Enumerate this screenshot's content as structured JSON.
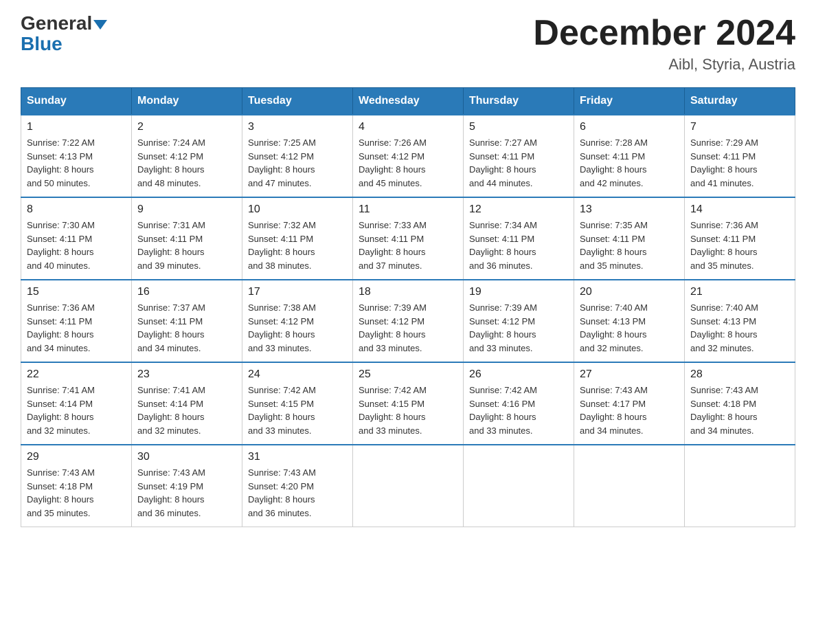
{
  "header": {
    "logo_line1": "General",
    "logo_line2": "Blue",
    "month_title": "December 2024",
    "subtitle": "Aibl, Styria, Austria"
  },
  "days_of_week": [
    "Sunday",
    "Monday",
    "Tuesday",
    "Wednesday",
    "Thursday",
    "Friday",
    "Saturday"
  ],
  "weeks": [
    [
      {
        "day": "1",
        "sunrise": "7:22 AM",
        "sunset": "4:13 PM",
        "daylight": "8 hours and 50 minutes."
      },
      {
        "day": "2",
        "sunrise": "7:24 AM",
        "sunset": "4:12 PM",
        "daylight": "8 hours and 48 minutes."
      },
      {
        "day": "3",
        "sunrise": "7:25 AM",
        "sunset": "4:12 PM",
        "daylight": "8 hours and 47 minutes."
      },
      {
        "day": "4",
        "sunrise": "7:26 AM",
        "sunset": "4:12 PM",
        "daylight": "8 hours and 45 minutes."
      },
      {
        "day": "5",
        "sunrise": "7:27 AM",
        "sunset": "4:11 PM",
        "daylight": "8 hours and 44 minutes."
      },
      {
        "day": "6",
        "sunrise": "7:28 AM",
        "sunset": "4:11 PM",
        "daylight": "8 hours and 42 minutes."
      },
      {
        "day": "7",
        "sunrise": "7:29 AM",
        "sunset": "4:11 PM",
        "daylight": "8 hours and 41 minutes."
      }
    ],
    [
      {
        "day": "8",
        "sunrise": "7:30 AM",
        "sunset": "4:11 PM",
        "daylight": "8 hours and 40 minutes."
      },
      {
        "day": "9",
        "sunrise": "7:31 AM",
        "sunset": "4:11 PM",
        "daylight": "8 hours and 39 minutes."
      },
      {
        "day": "10",
        "sunrise": "7:32 AM",
        "sunset": "4:11 PM",
        "daylight": "8 hours and 38 minutes."
      },
      {
        "day": "11",
        "sunrise": "7:33 AM",
        "sunset": "4:11 PM",
        "daylight": "8 hours and 37 minutes."
      },
      {
        "day": "12",
        "sunrise": "7:34 AM",
        "sunset": "4:11 PM",
        "daylight": "8 hours and 36 minutes."
      },
      {
        "day": "13",
        "sunrise": "7:35 AM",
        "sunset": "4:11 PM",
        "daylight": "8 hours and 35 minutes."
      },
      {
        "day": "14",
        "sunrise": "7:36 AM",
        "sunset": "4:11 PM",
        "daylight": "8 hours and 35 minutes."
      }
    ],
    [
      {
        "day": "15",
        "sunrise": "7:36 AM",
        "sunset": "4:11 PM",
        "daylight": "8 hours and 34 minutes."
      },
      {
        "day": "16",
        "sunrise": "7:37 AM",
        "sunset": "4:11 PM",
        "daylight": "8 hours and 34 minutes."
      },
      {
        "day": "17",
        "sunrise": "7:38 AM",
        "sunset": "4:12 PM",
        "daylight": "8 hours and 33 minutes."
      },
      {
        "day": "18",
        "sunrise": "7:39 AM",
        "sunset": "4:12 PM",
        "daylight": "8 hours and 33 minutes."
      },
      {
        "day": "19",
        "sunrise": "7:39 AM",
        "sunset": "4:12 PM",
        "daylight": "8 hours and 33 minutes."
      },
      {
        "day": "20",
        "sunrise": "7:40 AM",
        "sunset": "4:13 PM",
        "daylight": "8 hours and 32 minutes."
      },
      {
        "day": "21",
        "sunrise": "7:40 AM",
        "sunset": "4:13 PM",
        "daylight": "8 hours and 32 minutes."
      }
    ],
    [
      {
        "day": "22",
        "sunrise": "7:41 AM",
        "sunset": "4:14 PM",
        "daylight": "8 hours and 32 minutes."
      },
      {
        "day": "23",
        "sunrise": "7:41 AM",
        "sunset": "4:14 PM",
        "daylight": "8 hours and 32 minutes."
      },
      {
        "day": "24",
        "sunrise": "7:42 AM",
        "sunset": "4:15 PM",
        "daylight": "8 hours and 33 minutes."
      },
      {
        "day": "25",
        "sunrise": "7:42 AM",
        "sunset": "4:15 PM",
        "daylight": "8 hours and 33 minutes."
      },
      {
        "day": "26",
        "sunrise": "7:42 AM",
        "sunset": "4:16 PM",
        "daylight": "8 hours and 33 minutes."
      },
      {
        "day": "27",
        "sunrise": "7:43 AM",
        "sunset": "4:17 PM",
        "daylight": "8 hours and 34 minutes."
      },
      {
        "day": "28",
        "sunrise": "7:43 AM",
        "sunset": "4:18 PM",
        "daylight": "8 hours and 34 minutes."
      }
    ],
    [
      {
        "day": "29",
        "sunrise": "7:43 AM",
        "sunset": "4:18 PM",
        "daylight": "8 hours and 35 minutes."
      },
      {
        "day": "30",
        "sunrise": "7:43 AM",
        "sunset": "4:19 PM",
        "daylight": "8 hours and 36 minutes."
      },
      {
        "day": "31",
        "sunrise": "7:43 AM",
        "sunset": "4:20 PM",
        "daylight": "8 hours and 36 minutes."
      },
      null,
      null,
      null,
      null
    ]
  ],
  "labels": {
    "sunrise": "Sunrise:",
    "sunset": "Sunset:",
    "daylight": "Daylight:"
  }
}
